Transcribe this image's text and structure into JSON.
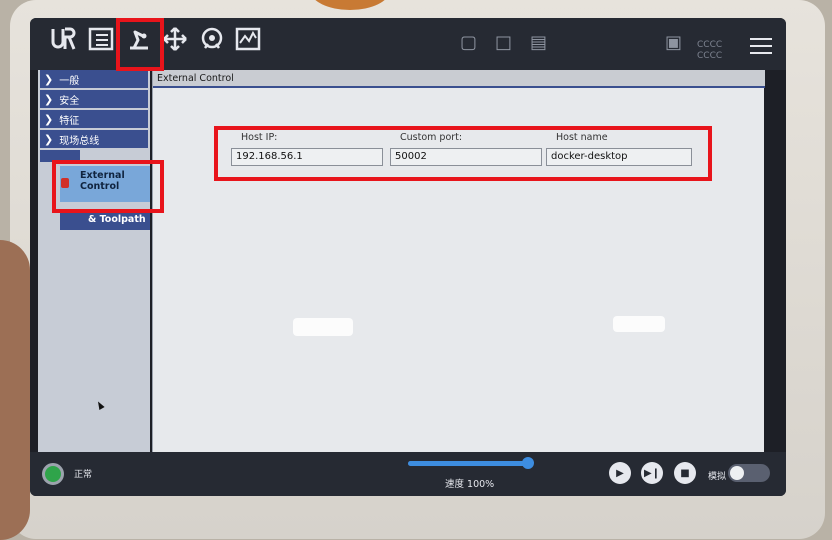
{
  "topbar": {
    "icons": [
      {
        "name": "ur-logo-icon",
        "caption": "UR"
      },
      {
        "name": "program-list-icon",
        "caption": "程序"
      },
      {
        "name": "installation-icon",
        "caption": "安装设置"
      },
      {
        "name": "move-icon",
        "caption": "移动"
      },
      {
        "name": "io-icon",
        "caption": "I/O"
      },
      {
        "name": "log-icon",
        "caption": "日志"
      }
    ],
    "right_text": "CCCC"
  },
  "sidebar": {
    "items": [
      {
        "label": "一般"
      },
      {
        "label": "安全"
      },
      {
        "label": "特征"
      },
      {
        "label": "现场总线"
      }
    ],
    "selected_sub": "External Control",
    "sub2": "& Toolpath"
  },
  "content": {
    "title": "External Control",
    "host_ip_label": "Host IP:",
    "host_ip_value": "192.168.56.1",
    "port_label": "Custom port:",
    "port_value": "50002",
    "hostname_label": "Host name",
    "hostname_value": "docker-desktop"
  },
  "bottombar": {
    "status": "正常",
    "speed_label": "速度 100%",
    "speed_fraction": 1.0,
    "sim_label": "模拟"
  },
  "colors": {
    "accent_blue": "#3a4f8f",
    "selected_sub": "#79a7d9",
    "highlight_red": "#e8141b",
    "status_green": "#2fa44a"
  }
}
